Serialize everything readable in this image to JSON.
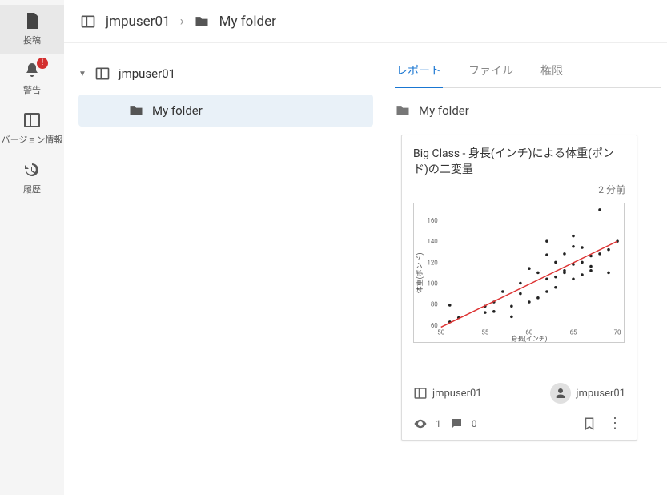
{
  "nav": {
    "post": {
      "label": "投稿"
    },
    "alert": {
      "label": "警告",
      "badge": "!"
    },
    "ver": {
      "label": "バージョン情報"
    },
    "hist": {
      "label": "履歴"
    }
  },
  "crumbs": {
    "root": "jmpuser01",
    "child": "My folder"
  },
  "tree": {
    "root": "jmpuser01",
    "child": "My folder"
  },
  "tabs": {
    "report": "レポート",
    "file": "ファイル",
    "perm": "権限"
  },
  "folder": {
    "name": "My folder"
  },
  "card": {
    "title": "Big Class - 身長(インチ)による体重(ポンド)の二変量",
    "time": "2 分前",
    "owner": "jmpuser01",
    "user": "jmpuser01",
    "views": "1",
    "comments": "0"
  },
  "chart_data": {
    "type": "scatter",
    "title": "Big Class - 身長(インチ)による体重(ポンド)の二変量",
    "xlabel": "身長(インチ)",
    "ylabel": "体重(ポンド)",
    "xlim": [
      50,
      70
    ],
    "ylim": [
      60,
      170
    ],
    "xticks": [
      50,
      55,
      60,
      65,
      70
    ],
    "yticks": [
      60,
      80,
      100,
      120,
      140,
      160
    ],
    "series": [
      {
        "name": "observations",
        "type": "scatter",
        "points": [
          [
            51,
            79
          ],
          [
            51,
            63
          ],
          [
            52,
            67
          ],
          [
            55,
            72
          ],
          [
            55,
            78
          ],
          [
            56,
            82
          ],
          [
            56,
            73
          ],
          [
            57,
            92
          ],
          [
            58,
            78
          ],
          [
            58,
            68
          ],
          [
            59,
            100
          ],
          [
            59,
            90
          ],
          [
            60,
            82
          ],
          [
            60,
            114
          ],
          [
            61,
            86
          ],
          [
            61,
            110
          ],
          [
            62,
            92
          ],
          [
            62,
            104
          ],
          [
            62,
            127
          ],
          [
            62,
            140
          ],
          [
            63,
            96
          ],
          [
            63,
            106
          ],
          [
            63,
            120
          ],
          [
            64,
            112
          ],
          [
            64,
            128
          ],
          [
            64,
            110
          ],
          [
            65,
            104
          ],
          [
            65,
            118
          ],
          [
            65,
            135
          ],
          [
            65,
            145
          ],
          [
            66,
            108
          ],
          [
            66,
            120
          ],
          [
            66,
            134
          ],
          [
            67,
            112
          ],
          [
            67,
            126
          ],
          [
            67,
            116
          ],
          [
            68,
            128
          ],
          [
            68,
            170
          ],
          [
            69,
            110
          ],
          [
            69,
            132
          ],
          [
            70,
            140
          ]
        ]
      },
      {
        "name": "fit",
        "type": "line",
        "points": [
          [
            50,
            58
          ],
          [
            70,
            140
          ]
        ]
      }
    ]
  }
}
